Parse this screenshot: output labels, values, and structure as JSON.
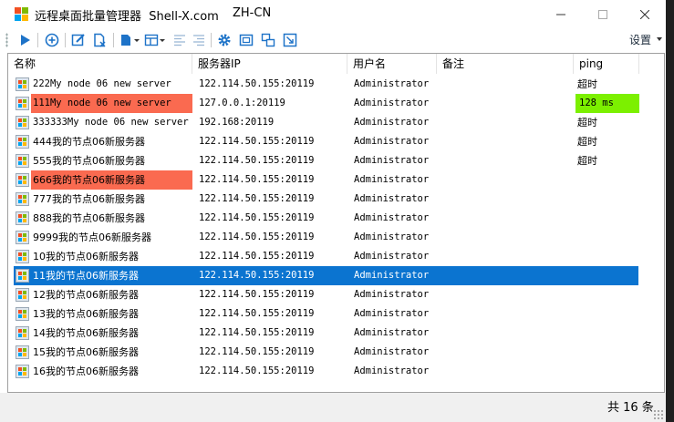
{
  "window": {
    "title": "远程桌面批量管理器  Shell-X.com",
    "language": "ZH-CN"
  },
  "toolbar": {
    "settings_label": "设置",
    "buttons": [
      "run-icon",
      "add-icon",
      "edit-icon",
      "delete-icon",
      "import-icon",
      "layout-icon",
      "align-left-icon",
      "align-right-icon",
      "gear-icon",
      "fullscreen-icon",
      "windows-icon",
      "capture-icon"
    ]
  },
  "table": {
    "columns": [
      "名称",
      "服务器IP",
      "用户名",
      "备注",
      "ping"
    ],
    "rows": [
      {
        "name": "222My node 06 new server",
        "ip": "122.114.50.155:20119",
        "user": "Administrator",
        "note": "",
        "ping": "超时",
        "state": "normal"
      },
      {
        "name": "111My node 06 new server",
        "ip": "127.0.0.1:20119",
        "user": "Administrator",
        "note": "",
        "ping": "128 ms",
        "state": "error",
        "ping_state": "ok"
      },
      {
        "name": "333333My node 06 new server",
        "ip": "192.168:20119",
        "user": "Administrator",
        "note": "",
        "ping": "超时",
        "state": "normal"
      },
      {
        "name": "444我的节点06新服务器",
        "ip": "122.114.50.155:20119",
        "user": "Administrator",
        "note": "",
        "ping": "超时",
        "state": "normal"
      },
      {
        "name": "555我的节点06新服务器",
        "ip": "122.114.50.155:20119",
        "user": "Administrator",
        "note": "",
        "ping": "超时",
        "state": "normal"
      },
      {
        "name": "666我的节点06新服务器",
        "ip": "122.114.50.155:20119",
        "user": "Administrator",
        "note": "",
        "ping": "",
        "state": "error"
      },
      {
        "name": "777我的节点06新服务器",
        "ip": "122.114.50.155:20119",
        "user": "Administrator",
        "note": "",
        "ping": "",
        "state": "normal"
      },
      {
        "name": "888我的节点06新服务器",
        "ip": "122.114.50.155:20119",
        "user": "Administrator",
        "note": "",
        "ping": "",
        "state": "normal"
      },
      {
        "name": "9999我的节点06新服务器",
        "ip": "122.114.50.155:20119",
        "user": "Administrator",
        "note": "",
        "ping": "",
        "state": "normal"
      },
      {
        "name": "10我的节点06新服务器",
        "ip": "122.114.50.155:20119",
        "user": "Administrator",
        "note": "",
        "ping": "",
        "state": "normal"
      },
      {
        "name": "11我的节点06新服务器",
        "ip": "122.114.50.155:20119",
        "user": "Administrator",
        "note": "",
        "ping": "",
        "state": "selected"
      },
      {
        "name": "12我的节点06新服务器",
        "ip": "122.114.50.155:20119",
        "user": "Administrator",
        "note": "",
        "ping": "",
        "state": "normal"
      },
      {
        "name": "13我的节点06新服务器",
        "ip": "122.114.50.155:20119",
        "user": "Administrator",
        "note": "",
        "ping": "",
        "state": "normal"
      },
      {
        "name": "14我的节点06新服务器",
        "ip": "122.114.50.155:20119",
        "user": "Administrator",
        "note": "",
        "ping": "",
        "state": "normal"
      },
      {
        "name": "15我的节点06新服务器",
        "ip": "122.114.50.155:20119",
        "user": "Administrator",
        "note": "",
        "ping": "",
        "state": "normal"
      },
      {
        "name": "16我的节点06新服务器",
        "ip": "122.114.50.155:20119",
        "user": "Administrator",
        "note": "",
        "ping": "",
        "state": "normal"
      }
    ]
  },
  "status": {
    "total_text": "共 16 条"
  },
  "colors": {
    "error_row": "#fa6a50",
    "selected_row": "#0b74d0",
    "ping_ok": "#7cf000",
    "toolbar_icon": "#1e73c8"
  }
}
